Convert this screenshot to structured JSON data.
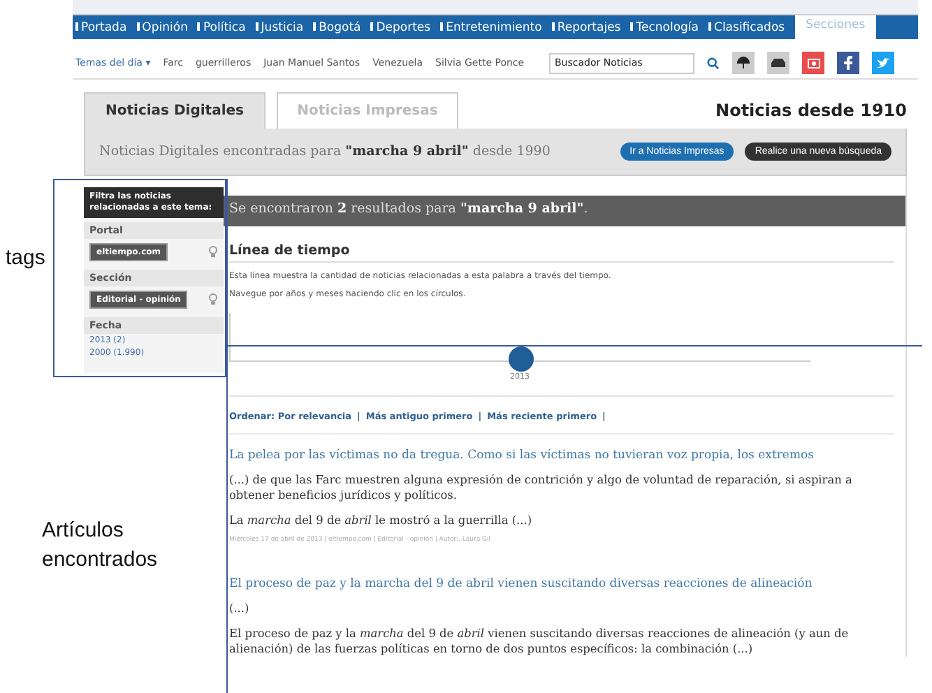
{
  "nav": {
    "items": [
      "Portada",
      "Opinión",
      "Política",
      "Justicia",
      "Bogotá",
      "Deportes",
      "Entretenimiento",
      "Reportajes",
      "Tecnología",
      "Clasificados"
    ],
    "sections_tab": "Secciones"
  },
  "topics": {
    "label": "Temas del día",
    "caret": "▾",
    "items": [
      "Farc",
      "guerrilleros",
      "Juan Manuel Santos",
      "Venezuela",
      "Silvia Gette Ponce"
    ],
    "search_placeholder": "Buscador Noticias"
  },
  "tabs": [
    {
      "label": "Noticias Digitales",
      "selected": true
    },
    {
      "label": "Noticias Impresas",
      "selected": false
    }
  ],
  "heading": "Noticias desde 1910",
  "summary": {
    "text": "Noticias Digitales encontradas para **\"marcha 9 abril\"** desde 1990",
    "buttons": [
      {
        "label": "Ir a Noticias Impresas",
        "kind": "primary"
      },
      {
        "label": "Realice una nueva búsqueda",
        "kind": "dark"
      }
    ]
  },
  "sidebar": {
    "title": "Filtra las noticias relacionadas a este tema:",
    "groups": [
      {
        "title": "Portal",
        "kind": "tags",
        "items": [
          "eltiempo.com"
        ]
      },
      {
        "title": "Sección",
        "kind": "tags",
        "items": [
          "Editorial - opinión"
        ]
      },
      {
        "title": "Fecha",
        "kind": "links",
        "items": [
          "2013 (2)",
          "2000 (1.990)"
        ]
      }
    ]
  },
  "results_banner": "Se encontraron **2** resultados para **\"marcha 9 abril\"**.",
  "timeline": {
    "title": "Línea de tiempo",
    "lines": [
      "Esta línea muestra la cantidad de noticias relacionadas a esta palabra a través del tiempo.",
      "Navegue por años y meses haciendo clic en los círculos."
    ],
    "year": "2013"
  },
  "sort": {
    "items": [
      "Ordenar: Por relevancia",
      "Más antiguo primero",
      "Más reciente primero"
    ],
    "separator": "|"
  },
  "articles": [
    {
      "title": "La pelea por las víctimas no da tregua. Como si las víctimas no tuvieran voz propia, los extremos",
      "excerpt": "(...) de que las Farc muestren alguna expresión de contrición y algo de voluntad de reparación, si aspiran a obtener beneficios jurídicos y políticos.",
      "snippet": "La *marcha* del 9 de *abril* le mostró a la guerrilla (...)",
      "meta": "Miércoles 17 de abril de 2013 | eltiempo.com | Editorial - opinión | Autor:. Laura Gil"
    },
    {
      "title": "El proceso de paz y la marcha del 9 de abril vienen suscitando diversas reacciones de alineación",
      "excerpt": "(...)",
      "snippet": "El proceso de paz y la *marcha* del 9 de *abril* vienen suscitando diversas reacciones de alineación (y aun de alienación) de las fuerzas políticas en torno de dos puntos específicos: la combinación (...)"
    }
  ],
  "annotations": [
    "tags",
    "Artículos encontrados"
  ]
}
